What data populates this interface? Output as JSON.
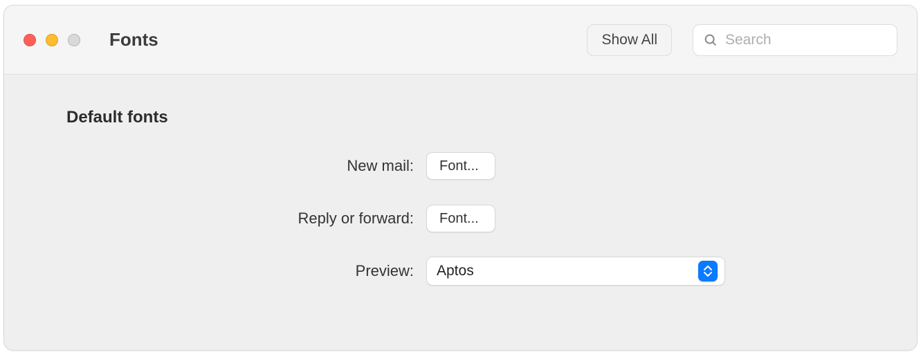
{
  "window": {
    "title": "Fonts"
  },
  "toolbar": {
    "show_all_label": "Show All",
    "search_placeholder": "Search"
  },
  "section": {
    "title": "Default fonts"
  },
  "form": {
    "new_mail": {
      "label": "New mail:",
      "button_label": "Font..."
    },
    "reply_forward": {
      "label": "Reply or forward:",
      "button_label": "Font..."
    },
    "preview": {
      "label": "Preview:",
      "selected_value": "Aptos"
    }
  }
}
